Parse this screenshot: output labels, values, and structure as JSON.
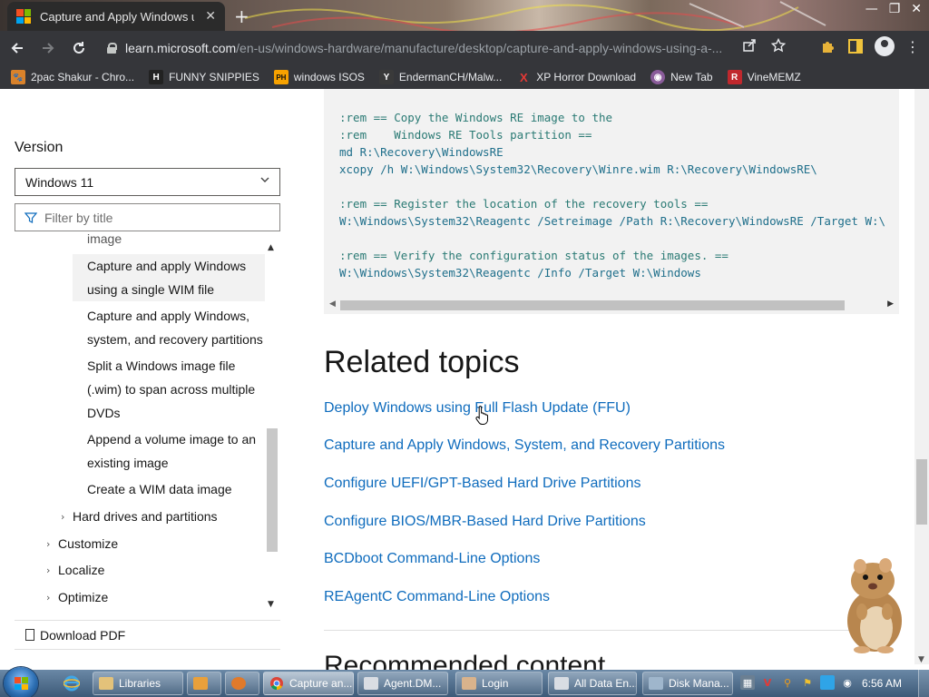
{
  "browser": {
    "tab_title": "Capture and Apply Windows usin",
    "tab_close": "✕",
    "new_tab": "+",
    "url_host": "learn.microsoft.com",
    "url_path": "/en-us/windows-hardware/manufacture/desktop/capture-and-apply-windows-using-a-...",
    "window_controls": [
      "—",
      "❐",
      "✕"
    ]
  },
  "bookmarks": [
    {
      "label": "2pac Shakur - Chro...",
      "icon": "paw-icon",
      "color": "#d9822b",
      "glyph": "🐾"
    },
    {
      "label": "FUNNY SNIPPIES",
      "icon": "h-logo-icon",
      "color": "#222222",
      "glyph": "H"
    },
    {
      "label": "windows ISOS",
      "icon": "ph-logo-icon",
      "color": "#f7a200",
      "glyph": "PH"
    },
    {
      "label": "EndermanCH/Malw...",
      "icon": "yp-logo-icon",
      "color": "#3a3a3a",
      "glyph": "Y"
    },
    {
      "label": "XP Horror Download",
      "icon": "red-x-icon",
      "color": "#35363a",
      "glyph": "X"
    },
    {
      "label": "New Tab",
      "icon": "globe-icon",
      "color": "#8a5c9a",
      "glyph": "◉"
    },
    {
      "label": "VineMEMZ",
      "icon": "r-logo-icon",
      "color": "#c0282d",
      "glyph": "R"
    }
  ],
  "sidebar": {
    "version_label": "Version",
    "version_value": "Windows 11",
    "filter_placeholder": "Filter by title",
    "toc": [
      {
        "text": "image",
        "clipped": true
      },
      {
        "text": "Capture and apply Windows",
        "active": true
      },
      {
        "text": "using a single WIM file",
        "active": true
      },
      {
        "text": "Capture and apply Windows,"
      },
      {
        "text": "system, and recovery partitions"
      },
      {
        "text": "Split a Windows image file"
      },
      {
        "text": "(.wim) to span across multiple"
      },
      {
        "text": "DVDs"
      },
      {
        "text": "Append a volume image to an"
      },
      {
        "text": "existing image"
      },
      {
        "text": "Create a WIM data image"
      },
      {
        "text": "Hard drives and partitions",
        "expandable": true
      },
      {
        "text": "Customize",
        "expandable": true
      },
      {
        "text": "Localize",
        "expandable": true
      },
      {
        "text": "Optimize",
        "expandable": true
      }
    ],
    "download_pdf": "Download PDF"
  },
  "code": {
    "lines": [
      {
        "text": ":rem == Copy the Windows RE image to the",
        "kind": "rem"
      },
      {
        "text": ":rem    Windows RE Tools partition ==",
        "kind": "rem"
      },
      {
        "text": "md R:\\Recovery\\WindowsRE",
        "kind": "cmd"
      },
      {
        "text": "xcopy /h W:\\Windows\\System32\\Recovery\\Winre.wim R:\\Recovery\\WindowsRE\\",
        "kind": "cmd"
      },
      {
        "text": "",
        "kind": "blank"
      },
      {
        "text": ":rem == Register the location of the recovery tools ==",
        "kind": "rem"
      },
      {
        "text": "W:\\Windows\\System32\\Reagentc /Setreimage /Path R:\\Recovery\\WindowsRE /Target W:\\",
        "kind": "cmd"
      },
      {
        "text": "",
        "kind": "blank"
      },
      {
        "text": ":rem == Verify the configuration status of the images. ==",
        "kind": "rem"
      },
      {
        "text": "W:\\Windows\\System32\\Reagentc /Info /Target W:\\Windows",
        "kind": "cmd"
      }
    ]
  },
  "related": {
    "title": "Related topics",
    "links": [
      "Deploy Windows using Full Flash Update (FFU)",
      "Capture and Apply Windows, System, and Recovery Partitions",
      "Configure UEFI/GPT-Based Hard Drive Partitions",
      "Configure BIOS/MBR-Based Hard Drive Partitions",
      "BCDboot Command-Line Options",
      "REAgentC Command-Line Options"
    ]
  },
  "recommended_title": "Recommended content",
  "taskbar": {
    "tasks": [
      {
        "label": "Libraries",
        "icon": "libraries-icon",
        "color": "#e3c27a"
      },
      {
        "label": "",
        "icon": "media-player-icon",
        "color": "#e9a03b"
      },
      {
        "label": "",
        "icon": "firefox-icon",
        "color": "#e07a2b"
      },
      {
        "label": "Capture an...",
        "icon": "chrome-icon",
        "color": "#4caf50",
        "active": true
      },
      {
        "label": "Agent.DM...",
        "icon": "window-icon",
        "color": "#d9dde3"
      },
      {
        "label": "Login",
        "icon": "user-icon",
        "color": "#d9b38c"
      },
      {
        "label": "All Data En...",
        "icon": "window-icon",
        "color": "#d9dde3"
      },
      {
        "label": "Disk Mana...",
        "icon": "disk-icon",
        "color": "#9fb6cc"
      }
    ],
    "clock": "6:56 AM"
  }
}
